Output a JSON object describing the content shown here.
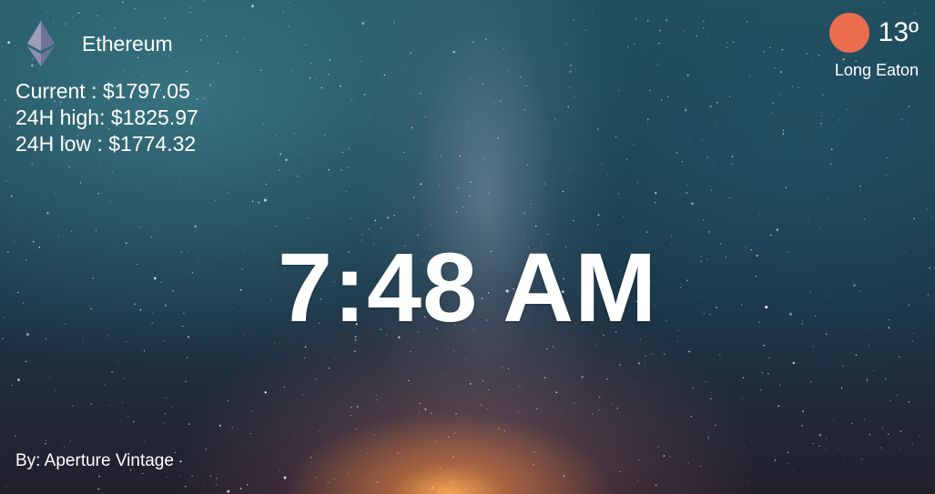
{
  "crypto": {
    "icon": "ethereum-icon",
    "name": "Ethereum",
    "current": "Current : $1797.05",
    "high": "24H high: $1825.97",
    "low": "24H low : $1774.32"
  },
  "weather": {
    "icon": "sun-icon",
    "temperature": "13º",
    "location": "Long Eaton",
    "icon_color": "#ea6e4d"
  },
  "clock": {
    "time": "7:48 AM"
  },
  "background": {
    "credit": "By: Aperture Vintage"
  }
}
